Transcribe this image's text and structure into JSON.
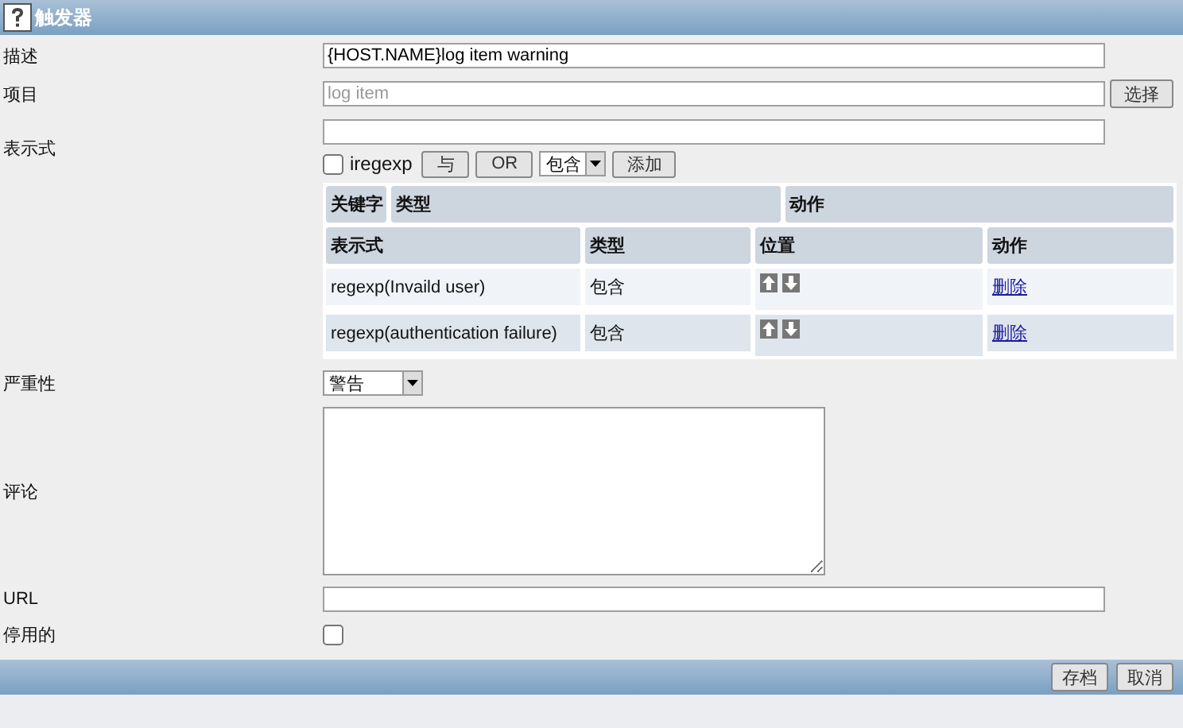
{
  "window": {
    "title": "触发器"
  },
  "description": {
    "label": "描述",
    "value": "{HOST.NAME}log item warning"
  },
  "item": {
    "label": "项目",
    "placeholder": "log item",
    "button": "选择"
  },
  "expression": {
    "label": "表示式",
    "iregexp": {
      "label": "iregexp",
      "checked": false
    },
    "buttons": [
      "与",
      "OR"
    ],
    "type_select": "包含",
    "add_button": "添加",
    "keyword_header": [
      "关键字",
      "类型",
      "动作"
    ],
    "columns": [
      "表示式",
      "类型",
      "位置",
      "动作"
    ],
    "rows": [
      {
        "expression": "regexp(Invaild user)",
        "type": "包含",
        "action": "删除"
      },
      {
        "expression": "regexp(authentication failure)",
        "type": "包含",
        "action": "删除"
      }
    ]
  },
  "severity": {
    "label": "严重性",
    "value": "警告"
  },
  "comment": {
    "label": "评论"
  },
  "url": {
    "label": "URL"
  },
  "disabled": {
    "label": "停用的",
    "checked": false
  },
  "footer": {
    "buttons": [
      "存档",
      "取消"
    ]
  }
}
